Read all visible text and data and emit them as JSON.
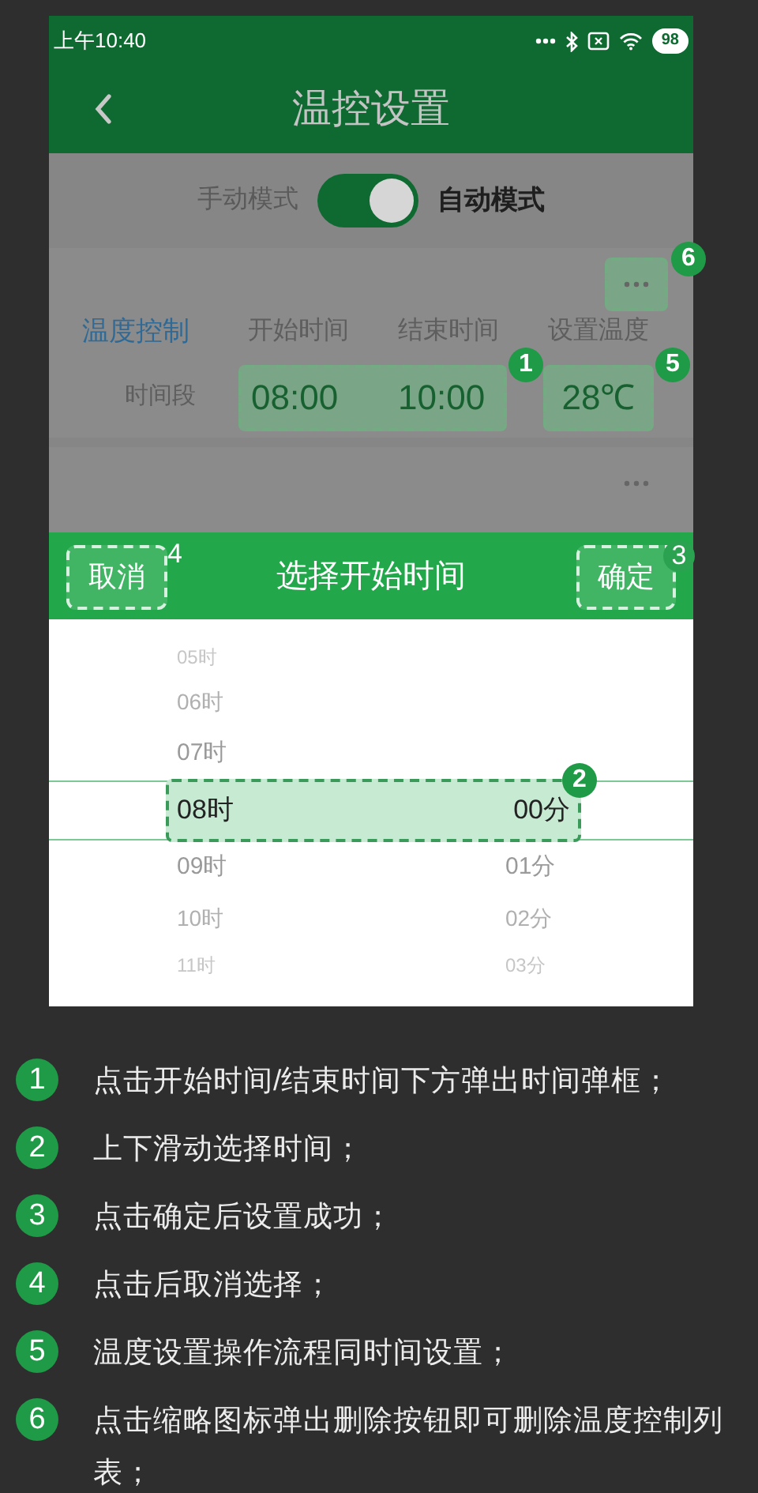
{
  "status_bar": {
    "time": "上午10:40",
    "battery": "98"
  },
  "header": {
    "title": "温控设置"
  },
  "mode_switch": {
    "left_label": "手动模式",
    "right_label": "自动模式",
    "on": true
  },
  "cards": [
    {
      "title": "温度控制",
      "subtitle": "时间段",
      "columns": [
        "开始时间",
        "结束时间",
        "设置温度"
      ],
      "start": "08:00",
      "end": "10:00",
      "temperature": "28℃",
      "time_badge": "1",
      "temperature_badge": "5",
      "more_button": true,
      "more_badge": "6"
    },
    {
      "more_button": true
    }
  ],
  "picker": {
    "cancel": "取消",
    "cancel_badge": "4",
    "title": "选择开始时间",
    "confirm": "确定",
    "confirm_badge": "3",
    "selection_badge": "2",
    "rows": [
      {
        "hour": "05时",
        "selected": false
      },
      {
        "hour": "06时",
        "selected": false
      },
      {
        "hour": "07时",
        "selected": false
      },
      {
        "hour": "08时",
        "minute": "00分",
        "selected": true
      },
      {
        "hour": "09时",
        "minute": "01分",
        "selected": false
      },
      {
        "hour": "10时",
        "minute": "02分",
        "selected": false
      },
      {
        "hour": "11时",
        "minute": "03分",
        "selected": false
      }
    ]
  },
  "steps": [
    {
      "number": "1",
      "text": "点击开始时间/结束时间下方弹出时间弹框；"
    },
    {
      "number": "2",
      "text": "上下滑动选择时间；"
    },
    {
      "number": "3",
      "text": "点击确定后设置成功；"
    },
    {
      "number": "4",
      "text": "点击后取消选择；"
    },
    {
      "number": "5",
      "text": "温度设置操作流程同时间设置；"
    },
    {
      "number": "6",
      "text": "点击缩略图标弹出删除按钮即可删除温度控制列表；"
    }
  ]
}
